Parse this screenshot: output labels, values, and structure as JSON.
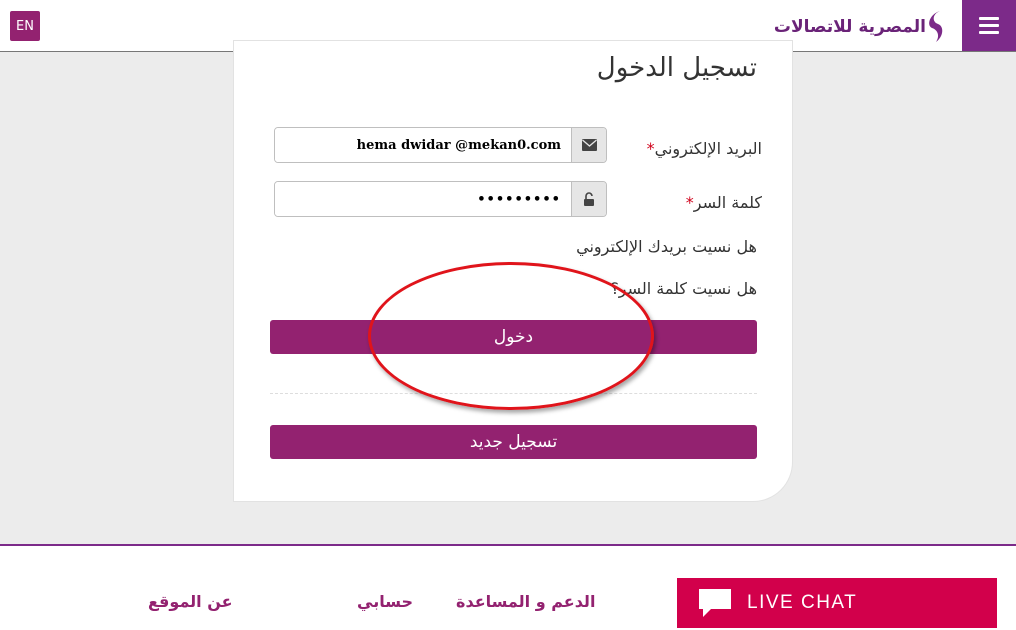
{
  "header": {
    "lang_button": "EN",
    "logo_text": "المصرية للاتصالات",
    "menu_icon": "hamburger-icon"
  },
  "login": {
    "title": "تسجيل الدخول",
    "email_label": "البريد الإلكتروني",
    "email_value": "hema dwidar @mekan0.com",
    "password_label": "كلمة السر",
    "password_value": "•••••••••",
    "required_mark": "*",
    "forgot_email": "هل نسيت بريدك الإلكتروني",
    "forgot_password": "هل نسيت كلمة السر؟",
    "login_button": "دخول",
    "register_button": "تسجيل جديد"
  },
  "footer": {
    "about": "عن الموقع",
    "account": "حسابي",
    "support": "الدعم و المساعدة",
    "live_chat": "LIVE CHAT"
  },
  "colors": {
    "brand": "#932270",
    "menu": "#7c2a89",
    "live_chat": "#d2004b",
    "annotation": "#e0141b"
  }
}
